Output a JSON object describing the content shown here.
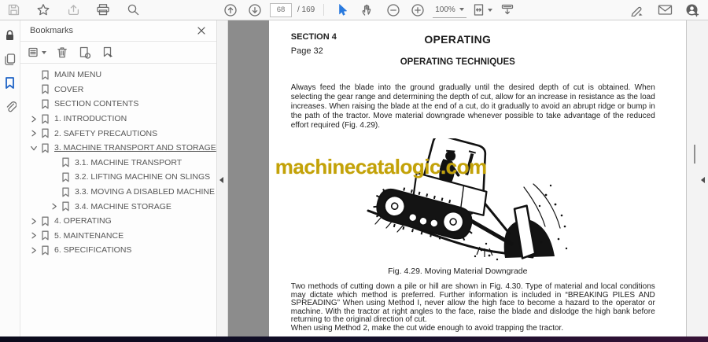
{
  "toolbar": {
    "page_current": "68",
    "page_total": "/ 169",
    "zoom_level": "100%",
    "icons": [
      "save-icon",
      "star-icon",
      "upload-icon",
      "print-icon",
      "search-icon",
      "page-up-icon",
      "page-down-icon",
      "select-tool-icon",
      "hand-tool-icon",
      "zoom-out-icon",
      "zoom-in-icon",
      "fit-page-icon",
      "scroll-mode-icon",
      "fill-sign-icon",
      "email-icon",
      "profile-add-icon"
    ],
    "active_tool": "select-tool-icon"
  },
  "rail": {
    "icons": [
      "lock-icon",
      "copy-pages-icon",
      "bookmarks-icon",
      "paperclip-icon"
    ],
    "active": "bookmarks-icon"
  },
  "bookmarks": {
    "title": "Bookmarks",
    "tool_icons": [
      "options-menu-icon",
      "trash-icon",
      "new-bookmark-icon",
      "goto-bookmark-icon",
      "close-icon"
    ],
    "items": [
      {
        "label": "MAIN MENU",
        "level": 1,
        "state": "leaf"
      },
      {
        "label": "COVER",
        "level": 1,
        "state": "leaf"
      },
      {
        "label": "SECTION CONTENTS",
        "level": 1,
        "state": "leaf"
      },
      {
        "label": "1. INTRODUCTION",
        "level": 1,
        "state": "collapsed"
      },
      {
        "label": "2. SAFETY PRECAUTIONS",
        "level": 1,
        "state": "collapsed"
      },
      {
        "label": "3. MACHINE TRANSPORT AND STORAGE",
        "level": 1,
        "state": "expanded",
        "selected": true
      },
      {
        "label": "3.1. MACHINE TRANSPORT",
        "level": 2,
        "state": "leaf"
      },
      {
        "label": "3.2. LIFTING MACHINE ON SLINGS",
        "level": 2,
        "state": "leaf"
      },
      {
        "label": "3.3. MOVING A DISABLED MACHINE",
        "level": 2,
        "state": "leaf"
      },
      {
        "label": "3.4. MACHINE STORAGE",
        "level": 2,
        "state": "collapsed"
      },
      {
        "label": "4. OPERATING",
        "level": 1,
        "state": "collapsed"
      },
      {
        "label": "5. MAINTENANCE",
        "level": 1,
        "state": "collapsed"
      },
      {
        "label": "6. SPECIFICATIONS",
        "level": 1,
        "state": "collapsed"
      }
    ]
  },
  "document": {
    "section_label": "SECTION 4",
    "page_label": "Page 32",
    "title": "OPERATING",
    "subtitle": "OPERATING TECHNIQUES",
    "paragraph_1": "Always feed the blade into the ground gradually until the desired depth of cut is obtained. When selecting the gear range and determining the depth of cut, allow for an increase in resistance as the load increases. When raising the blade at the end of a cut, do it gradually to avoid an abrupt ridge or bump in the path of the tractor. Move material downgrade whenever possible to take advantage of the reduced effort required (Fig. 4.29).",
    "watermark": "machinecatalogic.com",
    "figure_caption": "Fig. 4.29. Moving Material Downgrade",
    "figure_alt": "tractor-moving-material-downgrade-illustration",
    "paragraph_2": "Two methods of cutting down a pile or hill are shown in Fig. 4.30. Type of material and local conditions may dictate which method is preferred. Further information is included in “BREAKING PILES AND SPREADING” When using Method I, never allow the high face to become a hazard to the operator or machine. With the tractor at right angles to the face, raise the blade and dislodge the high bank before returning to the original direction of cut.",
    "paragraph_3": "When using Method 2, make the cut wide enough to avoid trapping the tractor."
  },
  "colors": {
    "watermark": "#c3a208",
    "accent_blue": "#2a7ade",
    "doc_background": "#8c8c8c",
    "bottom_bar_left": "#0b0b1c",
    "bottom_bar_right": "#371237"
  }
}
